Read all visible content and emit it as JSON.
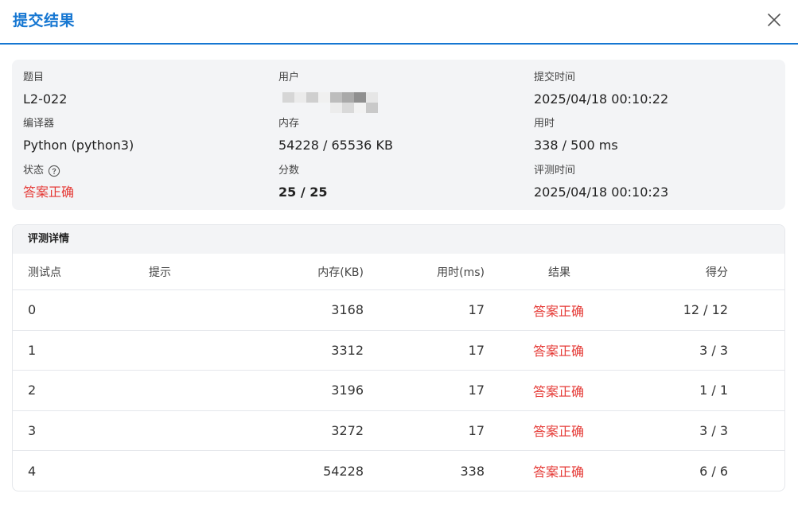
{
  "dialog": {
    "title": "提交结果"
  },
  "summary": {
    "problem_label": "题目",
    "problem_value": "L2-022",
    "user_label": "用户",
    "time_label": "提交时间",
    "time_value": "2025/04/18 00:10:22",
    "compiler_label": "编译器",
    "compiler_value": "Python (python3)",
    "memory_label": "内存",
    "memory_value": "54228 / 65536 KB",
    "usetime_label": "用时",
    "usetime_value": "338 / 500 ms",
    "status_label": "状态",
    "status_value": "答案正确",
    "score_label": "分数",
    "score_value": "25 / 25",
    "judge_time_label": "评测时间",
    "judge_time_value": "2025/04/18 00:10:23"
  },
  "details": {
    "title": "评测详情",
    "headers": {
      "case": "测试点",
      "hint": "提示",
      "memory": "内存(KB)",
      "time": "用时(ms)",
      "result": "结果",
      "score": "得分"
    },
    "rows": [
      {
        "case": "0",
        "hint": "",
        "memory": "3168",
        "time": "17",
        "result": "答案正确",
        "score": "12 / 12"
      },
      {
        "case": "1",
        "hint": "",
        "memory": "3312",
        "time": "17",
        "result": "答案正确",
        "score": "3 / 3"
      },
      {
        "case": "2",
        "hint": "",
        "memory": "3196",
        "time": "17",
        "result": "答案正确",
        "score": "1 / 1"
      },
      {
        "case": "3",
        "hint": "",
        "memory": "3272",
        "time": "17",
        "result": "答案正确",
        "score": "3 / 3"
      },
      {
        "case": "4",
        "hint": "",
        "memory": "54228",
        "time": "338",
        "result": "答案正确",
        "score": "6 / 6"
      }
    ]
  },
  "colors": {
    "accent": "#1677d2",
    "success_text": "#e53935",
    "panel_bg": "#f3f4f6"
  },
  "icons": {
    "close": "close-icon",
    "help": "question-circle-icon"
  }
}
